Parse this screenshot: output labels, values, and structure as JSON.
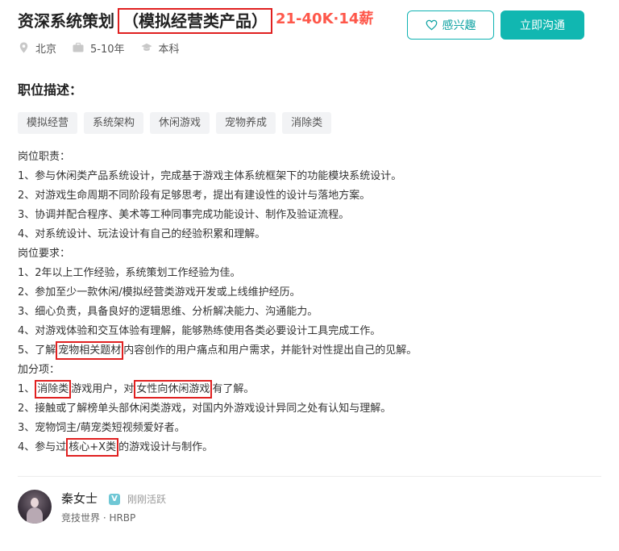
{
  "job": {
    "title_part1": "资深系统策划",
    "title_part2": "（模拟经营类产品）",
    "salary": "21-40K·14薪"
  },
  "actions": {
    "favorite_label": "感兴趣",
    "chat_label": "立即沟通",
    "favorite_icon": "heart-outline-icon"
  },
  "meta": {
    "location": "北京",
    "experience": "5-10年",
    "education": "本科",
    "icons": [
      "location-pin-icon",
      "briefcase-icon",
      "graduation-cap-icon"
    ]
  },
  "section_title": "职位描述：",
  "tags": [
    "模拟经营",
    "系统架构",
    "休闲游戏",
    "宠物养成",
    "消除类"
  ],
  "description": {
    "duties_heading": "岗位职责：",
    "duties": [
      "1、参与休闲类产品系统设计，完成基于游戏主体系统框架下的功能模块系统设计。",
      "2、对游戏生命周期不同阶段有足够思考，提出有建设性的设计与落地方案。",
      "3、协调并配合程序、美术等工种同事完成功能设计、制作及验证流程。",
      "4、对系统设计、玩法设计有自己的经验积累和理解。"
    ],
    "requirements_heading": "岗位要求：",
    "requirements": [
      "1、2年以上工作经验，系统策划工作经验为佳。",
      "2、参加至少一款休闲/模拟经营类游戏开发或上线维护经历。",
      "3、细心负责，具备良好的逻辑思维、分析解决能力、沟通能力。",
      "4、对游戏体验和交互体验有理解，能够熟练使用各类必要设计工具完成工作。"
    ],
    "req5": {
      "prefix": "5、了解",
      "highlight": "宠物相关题材",
      "suffix": "内容创作的用户痛点和用户需求，并能针对性提出自己的见解。"
    },
    "bonus_heading": "加分项：",
    "bonus1": {
      "prefix": "1、",
      "highlight1": "消除类",
      "middle": "游戏用户，对",
      "highlight2": "女性向休闲游戏",
      "suffix": "有了解。"
    },
    "bonus2": "2、接触或了解榜单头部休闲类游戏，对国内外游戏设计异同之处有认知与理解。",
    "bonus3": "3、宠物饲主/萌宠类短视频爱好者。",
    "bonus4": {
      "prefix": "4、参与过",
      "highlight": "核心+X类",
      "suffix": "的游戏设计与制作。"
    }
  },
  "recruiter": {
    "name": "秦女士",
    "badge": "V",
    "status": "刚刚活跃",
    "company": "竞技世界 · HRBP"
  },
  "colors": {
    "accent": "#11b7b1",
    "salary": "#fe574a",
    "highlight_box": "#e02020"
  }
}
